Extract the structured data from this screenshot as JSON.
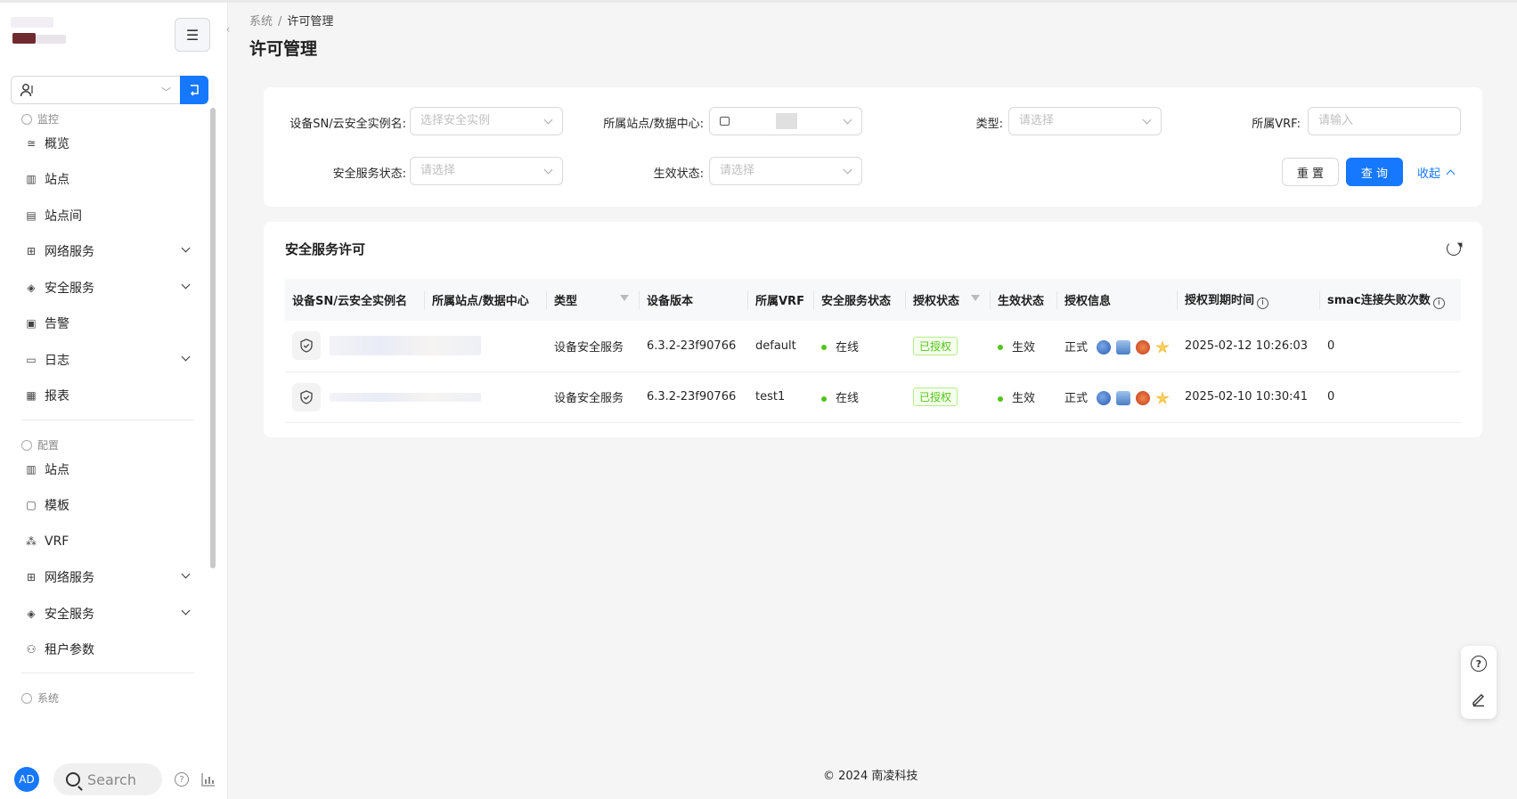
{
  "sidebar": {
    "collapse_icon": "menu-icon",
    "tenant": {
      "value": ""
    },
    "monitor_section": "监控",
    "monitor_items": [
      {
        "label": "概览",
        "icon": "overview-icon"
      },
      {
        "label": "站点",
        "icon": "site-icon"
      },
      {
        "label": "站点间",
        "icon": "inter-site-icon"
      },
      {
        "label": "网络服务",
        "icon": "network-service-icon",
        "expandable": true
      },
      {
        "label": "安全服务",
        "icon": "security-service-icon",
        "expandable": true
      },
      {
        "label": "告警",
        "icon": "alarm-icon"
      },
      {
        "label": "日志",
        "icon": "log-icon",
        "expandable": true
      },
      {
        "label": "报表",
        "icon": "report-icon"
      }
    ],
    "config_section": "配置",
    "config_items": [
      {
        "label": "站点",
        "icon": "site-icon"
      },
      {
        "label": "模板",
        "icon": "template-icon"
      },
      {
        "label": "VRF",
        "icon": "vrf-icon"
      },
      {
        "label": "网络服务",
        "icon": "network-service-icon",
        "expandable": true
      },
      {
        "label": "安全服务",
        "icon": "security-service-icon",
        "expandable": true
      },
      {
        "label": "租户参数",
        "icon": "tenant-param-icon"
      }
    ],
    "system_section": "系统",
    "avatar": "AD",
    "search_label": "Search"
  },
  "breadcrumb": {
    "parent": "系统",
    "separator": "/",
    "current": "许可管理"
  },
  "page_title": "许可管理",
  "filters": {
    "sn_label": "设备SN/云安全实例名:",
    "sn_placeholder": "选择安全实例",
    "site_label": "所属站点/数据中心:",
    "type_label": "类型:",
    "type_placeholder": "请选择",
    "vrf_label": "所属VRF:",
    "vrf_placeholder": "请输入",
    "service_status_label": "安全服务状态:",
    "service_status_placeholder": "请选择",
    "effect_status_label": "生效状态:",
    "effect_status_placeholder": "请选择",
    "reset": "重 置",
    "query": "查 询",
    "collapse": "收起"
  },
  "table": {
    "title": "安全服务许可",
    "columns": [
      "设备SN/云安全实例名",
      "所属站点/数据中心",
      "类型",
      "设备版本",
      "所属VRF",
      "安全服务状态",
      "授权状态",
      "生效状态",
      "授权信息",
      "授权到期时间",
      "smac连接失败次数"
    ],
    "rows": [
      {
        "type": "设备安全服务",
        "version": "6.3.2-23f90766",
        "vrf": "default",
        "service_status": "在线",
        "auth_status": "已授权",
        "effect_status": "生效",
        "auth_info": "正式",
        "expire": "2025-02-12 10:26:03",
        "smac_fail": "0"
      },
      {
        "type": "设备安全服务",
        "version": "6.3.2-23f90766",
        "vrf": "test1",
        "service_status": "在线",
        "auth_status": "已授权",
        "effect_status": "生效",
        "auth_info": "正式",
        "expire": "2025-02-10 10:30:41",
        "smac_fail": "0"
      }
    ]
  },
  "footer": "© 2024 南凌科技",
  "colors": {
    "primary": "#1677ff",
    "success": "#52c41a"
  }
}
